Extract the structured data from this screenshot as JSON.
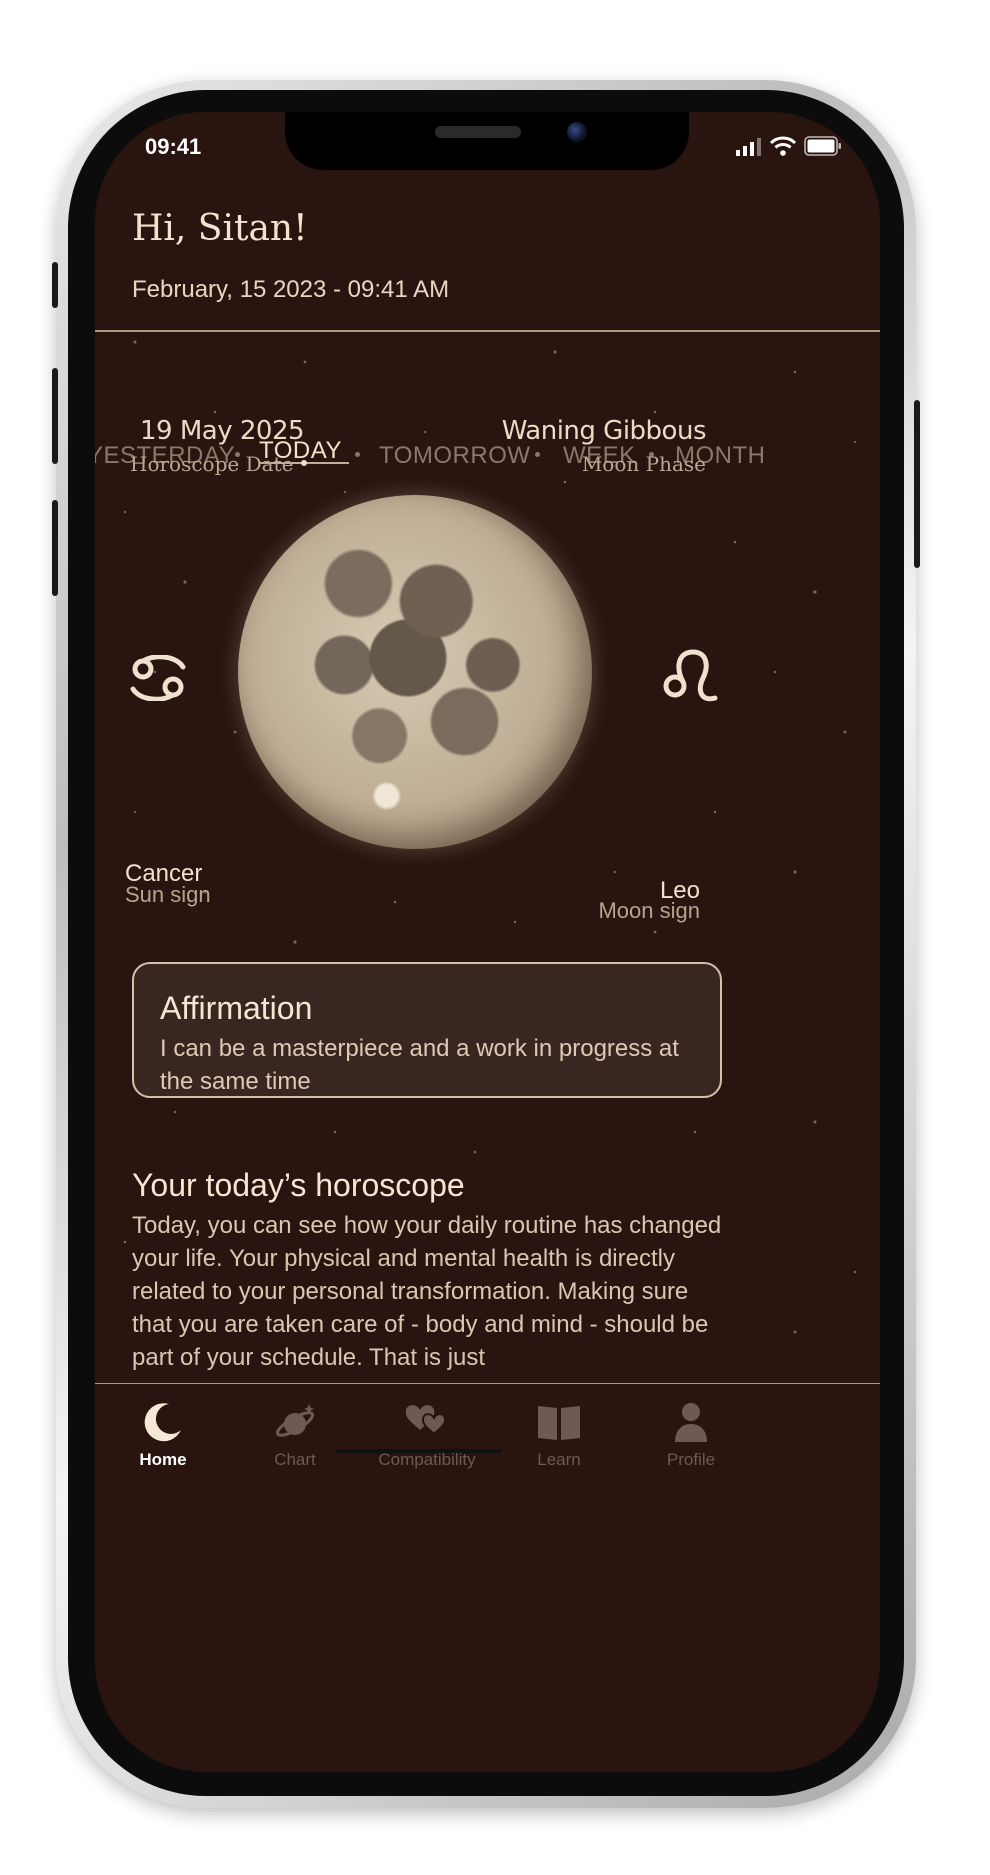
{
  "status_bar": {
    "time": "09:41"
  },
  "header": {
    "greeting": "Hi, Sitan!",
    "datetime": "February, 15 2023 - 09:41 AM"
  },
  "tabs": [
    {
      "label": "YESTERDAY",
      "active": false
    },
    {
      "label": "TODAY",
      "active": true
    },
    {
      "label": "TOMORROW",
      "active": false
    },
    {
      "label": "WEEK",
      "active": false
    },
    {
      "label": "MONTH",
      "active": false
    }
  ],
  "info": {
    "horoscope_date": {
      "value": "19 May 2025",
      "label": "Horoscope Date"
    },
    "moon_phase": {
      "value": "Waning Gibbous",
      "label": "Moon Phase"
    }
  },
  "signs": {
    "sun": {
      "name": "Cancer",
      "sub": "Sun sign",
      "glyph": "cancer-icon"
    },
    "moon": {
      "name": "Leo",
      "sub": "Moon sign",
      "glyph": "leo-icon"
    }
  },
  "affirmation": {
    "title": "Affirmation",
    "text": "I can be a masterpiece and a work in progress at the same time"
  },
  "horoscope": {
    "title": "Your today’s horoscope",
    "body": "Today, you can see how your daily routine has changed your life. Your physical and mental health is directly related to your personal transformation. Making sure that you are taken care of - body and mind - should be part of your schedule. That is just"
  },
  "nav": [
    {
      "label": "Home",
      "icon": "moon-icon",
      "active": true
    },
    {
      "label": "Chart",
      "icon": "planet-icon",
      "active": false
    },
    {
      "label": "Compatibility",
      "icon": "hearts-icon",
      "active": false
    },
    {
      "label": "Learn",
      "icon": "book-icon",
      "active": false
    },
    {
      "label": "Profile",
      "icon": "person-icon",
      "active": false
    }
  ],
  "colors": {
    "background": "#2a140f",
    "text_primary": "#f1e3cf",
    "text_muted": "#8e766b",
    "border": "#d4c1aa"
  }
}
